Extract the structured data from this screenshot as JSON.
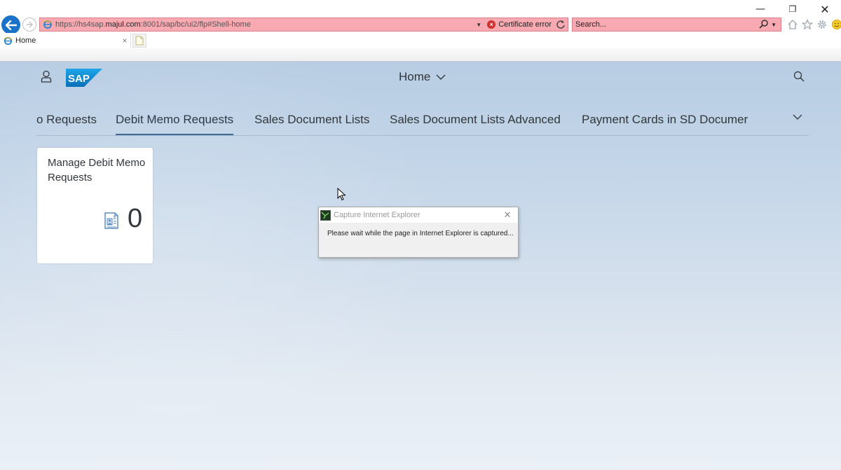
{
  "browser": {
    "url_prefix": "https://hs4sap.",
    "url_host": "majul.com",
    "url_suffix": ":8001/sap/bc/ui2/flp#Shell-home",
    "certificate_error": "Certificate error",
    "search_placeholder": "Search...",
    "tab_title": "Home",
    "tab_close": "×",
    "window_controls": {
      "minimize": "—",
      "restore": "❐",
      "close": "✕"
    }
  },
  "shell": {
    "title": "Home"
  },
  "anchor_bar": {
    "items": [
      "o Requests",
      "Debit Memo Requests",
      "Sales Document Lists",
      "Sales Document Lists Advanced",
      "Payment Cards in SD Documer"
    ],
    "selected_index": 1
  },
  "tile": {
    "title": "Manage Debit Memo Requests",
    "count": "0"
  },
  "dialog": {
    "title": "Capture Internet Explorer",
    "message": "Please wait while the page in Internet Explorer is captured...",
    "close": "✕"
  },
  "colors": {
    "address_bar_error": "#f8a9b1",
    "back_button": "#1a73c8",
    "sap_blue": "#1a8fd8",
    "anchor_underline": "#3d6a95"
  }
}
